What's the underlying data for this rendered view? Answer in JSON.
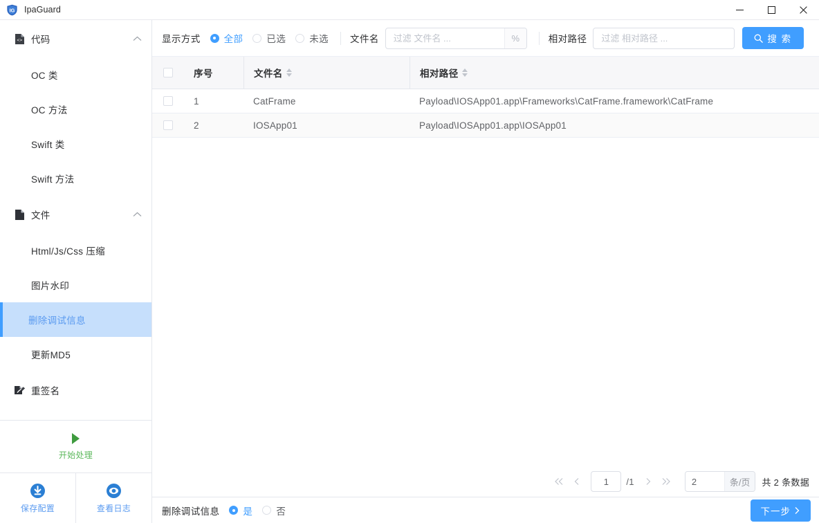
{
  "window": {
    "title": "IpaGuard",
    "logo_icon": "shield-ig-icon",
    "minimize_label": "—",
    "maximize_label": "□",
    "close_label": "✕"
  },
  "colors": {
    "accent": "#409eff",
    "selected_nav_bg": "#c6dffc",
    "selected_nav_text": "#5b9bf0",
    "start_green": "#5cb85c",
    "header_bg": "#f7f7f9",
    "row_alt_bg": "#fafafa",
    "border": "#e4e7ed"
  },
  "sidebar": {
    "groups": [
      {
        "label": "代码",
        "icon": "code-file-icon",
        "chevron": "chevron-up-icon",
        "items": [
          {
            "label": "OC 类",
            "active": false
          },
          {
            "label": "OC 方法",
            "active": false
          },
          {
            "label": "Swift 类",
            "active": false
          },
          {
            "label": "Swift 方法",
            "active": false
          }
        ]
      },
      {
        "label": "文件",
        "icon": "file-icon",
        "chevron": "chevron-up-icon",
        "items": [
          {
            "label": "Html/Js/Css 压缩",
            "active": false
          },
          {
            "label": "图片水印",
            "active": false
          },
          {
            "label": "删除调试信息",
            "active": true
          },
          {
            "label": "更新MD5",
            "active": false
          }
        ]
      },
      {
        "label": "重签名",
        "icon": "resign-pen-icon",
        "chevron": "",
        "items": []
      }
    ],
    "start": {
      "label": "开始处理",
      "icon": "play-triangle-icon"
    },
    "bottom_actions": [
      {
        "label": "保存配置",
        "icon": "download-circle-icon"
      },
      {
        "label": "查看日志",
        "icon": "eye-circle-icon"
      }
    ]
  },
  "toolbar": {
    "display_mode_label": "显示方式",
    "display_modes": [
      {
        "label": "全部",
        "checked": true
      },
      {
        "label": "已选",
        "checked": false
      },
      {
        "label": "未选",
        "checked": false
      }
    ],
    "filename_label": "文件名",
    "filename_value": "",
    "filename_placeholder": "过滤 文件名 ...",
    "filename_suffix_icon": "percent-icon",
    "filename_suffix_text": "%",
    "relpath_label": "相对路径",
    "relpath_value": "",
    "relpath_placeholder": "过滤 相对路径 ...",
    "search_label": "搜 索",
    "search_icon": "search-icon"
  },
  "table": {
    "select_all_checked": false,
    "columns": [
      {
        "key": "checkbox",
        "label": "",
        "sortable": false
      },
      {
        "key": "index",
        "label": "序号",
        "sortable": false
      },
      {
        "key": "filename",
        "label": "文件名",
        "sortable": true
      },
      {
        "key": "relpath",
        "label": "相对路径",
        "sortable": true
      }
    ],
    "rows": [
      {
        "checked": false,
        "index": "1",
        "filename": "CatFrame",
        "relpath": "Payload\\IOSApp01.app\\Frameworks\\CatFrame.framework\\CatFrame"
      },
      {
        "checked": false,
        "index": "2",
        "filename": "IOSApp01",
        "relpath": "Payload\\IOSApp01.app\\IOSApp01"
      }
    ]
  },
  "pagination": {
    "first_icon": "double-chevron-left-icon",
    "prev_icon": "chevron-left-icon",
    "current_page": "1",
    "total_pages_label": "/1",
    "next_icon": "chevron-right-icon",
    "last_icon": "double-chevron-right-icon",
    "page_size": "2",
    "page_size_suffix": "条/页",
    "total_label": "共 2 条数据"
  },
  "footer": {
    "option_label": "删除调试信息",
    "options": [
      {
        "label": "是",
        "checked": true
      },
      {
        "label": "否",
        "checked": false
      }
    ],
    "next_button_label": "下一步",
    "next_button_icon": "chevron-right-icon"
  }
}
